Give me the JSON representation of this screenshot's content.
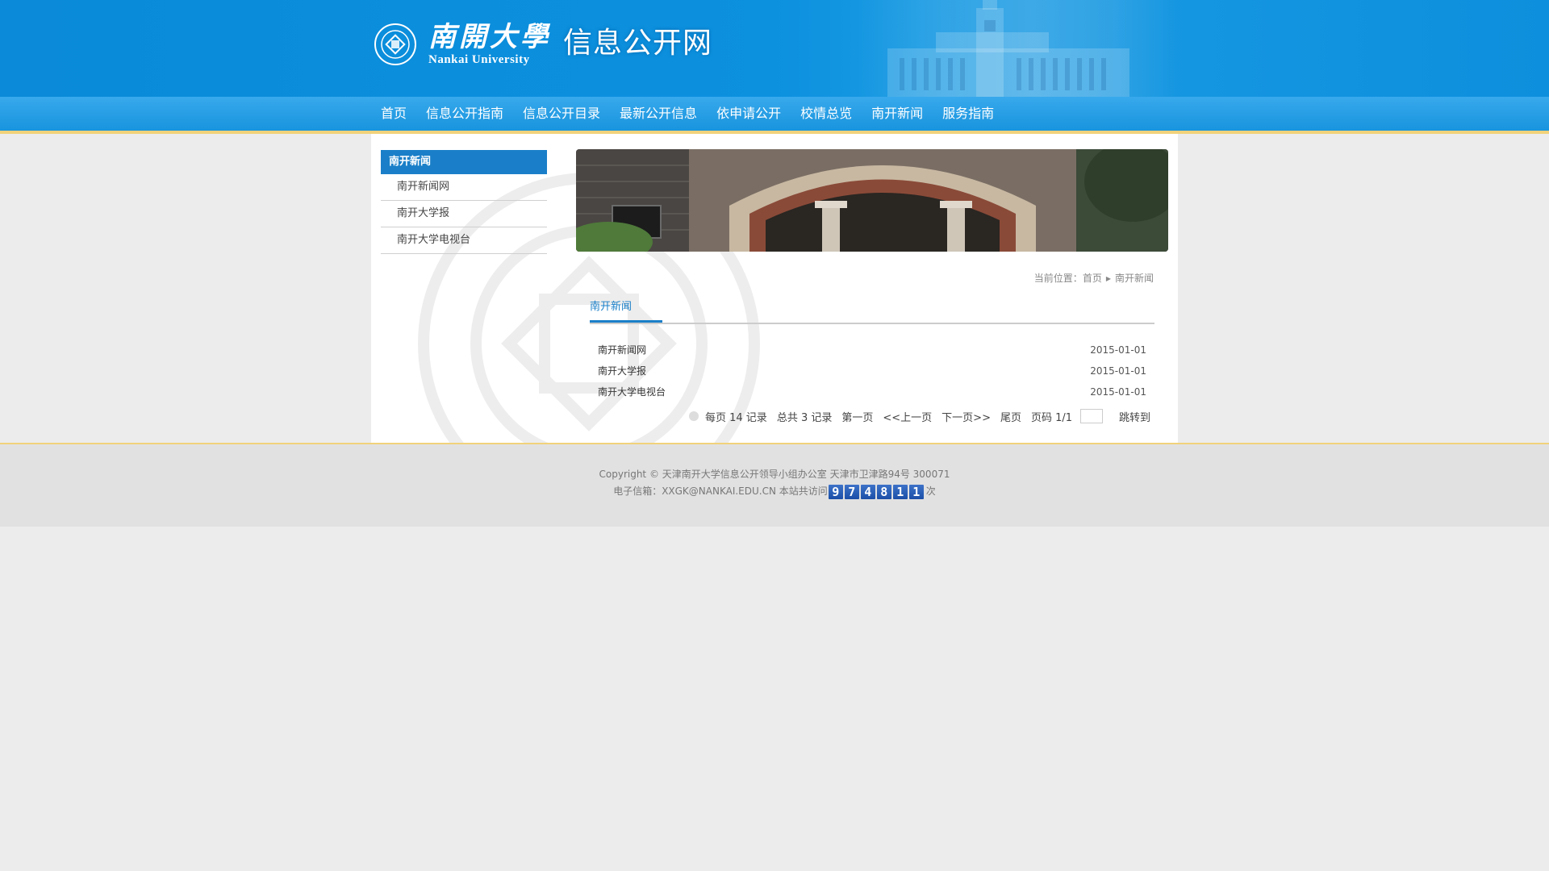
{
  "header": {
    "logo_cn": "南開大學",
    "logo_en": "Nankai University",
    "site_title": "信息公开网"
  },
  "nav": {
    "items": [
      "首页",
      "信息公开指南",
      "信息公开目录",
      "最新公开信息",
      "依申请公开",
      "校情总览",
      "南开新闻",
      "服务指南"
    ]
  },
  "sidebar": {
    "heading": "南开新闻",
    "items": [
      "南开新闻网",
      "南开大学报",
      "南开大学电视台"
    ]
  },
  "breadcrumb": {
    "prefix": "当前位置：",
    "home": "首页",
    "current": "南开新闻"
  },
  "section_tab": "南开新闻",
  "news_list": [
    {
      "title": "南开新闻网",
      "date": "2015-01-01"
    },
    {
      "title": "南开大学报",
      "date": "2015-01-01"
    },
    {
      "title": "南开大学电视台",
      "date": "2015-01-01"
    }
  ],
  "pager": {
    "per_page": "每页 14 记录",
    "total": "总共 3 记录",
    "first": "第一页",
    "prev": "<<上一页",
    "next": "下一页>>",
    "last": "尾页",
    "page_info": "页码 1/1",
    "jump": "跳转到"
  },
  "footer": {
    "copyright": "Copyright © 天津南开大学信息公开领导小组办公室 天津市卫津路94号 300071",
    "email_prefix": "电子信箱：XXGK@NANKAI.EDU.CN 本站共访问",
    "visit_count_digits": [
      "9",
      "7",
      "4",
      "8",
      "1",
      "1"
    ],
    "email_suffix": "次"
  },
  "colors": {
    "header_blue": "#0c8fdd",
    "nav_blue": "#2a9fe6",
    "accent_blue": "#1a7fc8",
    "gold_line": "#f1d27b"
  }
}
